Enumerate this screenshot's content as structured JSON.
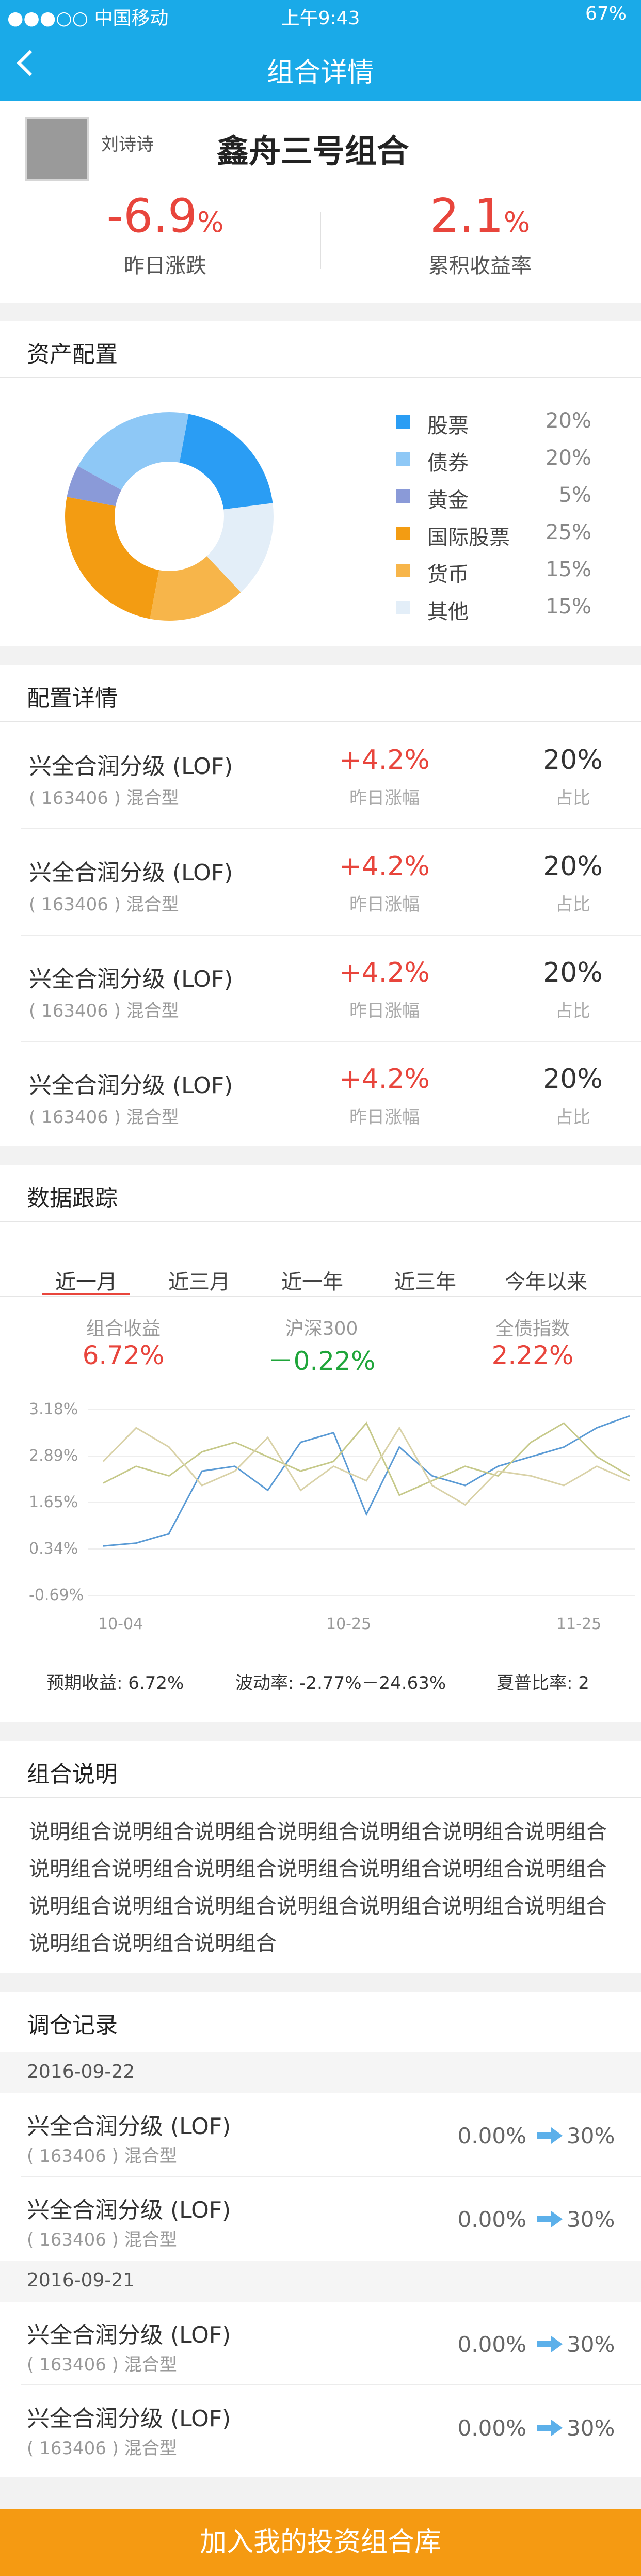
{
  "status_bar": {
    "carrier": "●●●○○ 中国移动",
    "time": "上午9:43",
    "battery": "67%"
  },
  "nav": {
    "title": "组合详情"
  },
  "header": {
    "user_name": "刘诗诗",
    "portfolio_name": "鑫舟三号组合",
    "yesterday_change": "-6.9",
    "yesterday_change_unit": "%",
    "yesterday_change_label": "昨日涨跌",
    "cumulative_return": "2.1",
    "cumulative_return_unit": "%",
    "cumulative_return_label": "累积收益率"
  },
  "allocation": {
    "title": "资产配置",
    "items": [
      {
        "name": "股票",
        "value": "20%",
        "color": "#2a9df4"
      },
      {
        "name": "债券",
        "value": "20%",
        "color": "#8ec8f6"
      },
      {
        "name": "黄金",
        "value": "5%",
        "color": "#8a9ad8"
      },
      {
        "name": "国际股票",
        "value": "25%",
        "color": "#f39c12"
      },
      {
        "name": "货币",
        "value": "15%",
        "color": "#f7b54a"
      },
      {
        "name": "其他",
        "value": "15%",
        "color": "#e3eef8"
      }
    ]
  },
  "config_detail": {
    "title": "配置详情",
    "change_label": "昨日涨幅",
    "pct_label": "占比",
    "funds": [
      {
        "name": "兴全合润分级 (LOF)",
        "code": "( 163406 ) 混合型",
        "change": "+4.2%",
        "pct": "20%"
      },
      {
        "name": "兴全合润分级 (LOF)",
        "code": "( 163406 ) 混合型",
        "change": "+4.2%",
        "pct": "20%"
      },
      {
        "name": "兴全合润分级 (LOF)",
        "code": "( 163406 ) 混合型",
        "change": "+4.2%",
        "pct": "20%"
      },
      {
        "name": "兴全合润分级 (LOF)",
        "code": "( 163406 ) 混合型",
        "change": "+4.2%",
        "pct": "20%"
      }
    ]
  },
  "tracking": {
    "title": "数据跟踪",
    "tabs": [
      "近一月",
      "近三月",
      "近一年",
      "近三年",
      "今年以来"
    ],
    "active_tab": 0,
    "indices": [
      {
        "label": "组合收益",
        "value": "6.72%",
        "color": "#e8453c"
      },
      {
        "label": "沪深300",
        "value": "－0.22%",
        "color": "#1fa53a"
      },
      {
        "label": "全债指数",
        "value": "2.22%",
        "color": "#e8453c"
      }
    ],
    "metrics": [
      {
        "label": "预期收益:",
        "value": "6.72%"
      },
      {
        "label": "波动率:",
        "value": "-2.77%－24.63%"
      },
      {
        "label": "夏普比率:",
        "value": "2"
      }
    ]
  },
  "chart_data": {
    "type": "line",
    "y_ticks": [
      "3.18%",
      "2.89%",
      "1.65%",
      "0.34%",
      "-0.69%"
    ],
    "x_ticks": [
      "10-04",
      "10-25",
      "11-25"
    ],
    "ylim": [
      -0.69,
      3.18
    ],
    "series": [
      {
        "color": "#5b9bd5",
        "values": [
          0.34,
          0.4,
          0.6,
          1.9,
          2.0,
          1.5,
          2.5,
          2.7,
          1.0,
          2.4,
          1.8,
          1.6,
          2.0,
          2.2,
          2.4,
          2.8,
          3.05
        ]
      },
      {
        "color": "#c6c98a",
        "values": [
          1.65,
          2.0,
          1.8,
          2.3,
          2.5,
          2.2,
          1.9,
          2.1,
          2.9,
          1.4,
          1.7,
          2.0,
          1.8,
          2.5,
          2.9,
          2.2,
          1.8
        ]
      },
      {
        "color": "#d9d2a8",
        "values": [
          2.1,
          2.8,
          2.4,
          1.6,
          1.9,
          2.6,
          1.5,
          2.0,
          1.7,
          2.8,
          1.6,
          1.2,
          1.9,
          1.8,
          1.6,
          2.0,
          1.7
        ]
      }
    ]
  },
  "description": {
    "title": "组合说明",
    "text": "说明组合说明组合说明组合说明组合说明组合说明组合说明组合说明组合说明组合说明组合说明组合说明组合说明组合说明组合说明组合说明组合说明组合说明组合说明组合说明组合说明组合说明组合说明组合说明组合"
  },
  "rebalance": {
    "title": "调仓记录",
    "groups": [
      {
        "date": "2016-09-22",
        "items": [
          {
            "name": "兴全合润分级 (LOF)",
            "code": "( 163406 ) 混合型",
            "from": "0.00%",
            "to": "30%"
          },
          {
            "name": "兴全合润分级 (LOF)",
            "code": "( 163406 ) 混合型",
            "from": "0.00%",
            "to": "30%"
          }
        ]
      },
      {
        "date": "2016-09-21",
        "items": [
          {
            "name": "兴全合润分级 (LOF)",
            "code": "( 163406 ) 混合型",
            "from": "0.00%",
            "to": "30%"
          },
          {
            "name": "兴全合润分级 (LOF)",
            "code": "( 163406 ) 混合型",
            "from": "0.00%",
            "to": "30%"
          }
        ]
      }
    ]
  },
  "bottom_button": "加入我的投资组合库"
}
